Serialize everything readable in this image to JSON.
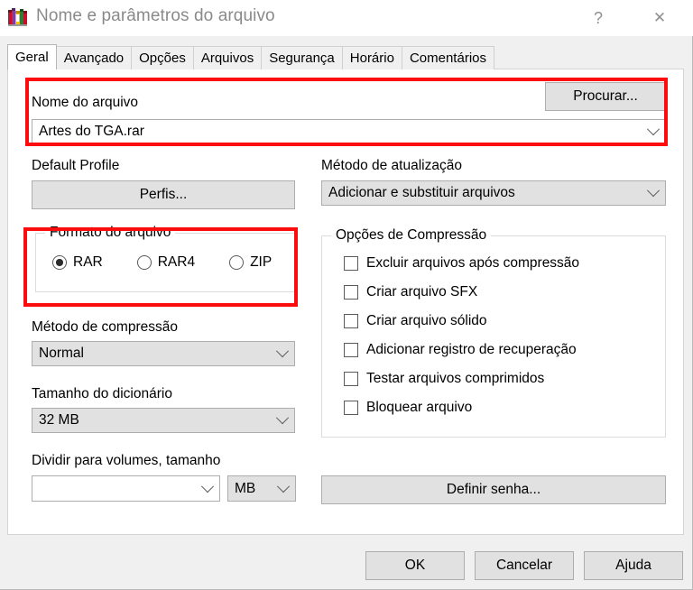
{
  "window": {
    "title": "Nome e parâmetros do arquivo",
    "icon": "winrar-books-icon",
    "help_glyph": "?",
    "close_glyph": "✕",
    "accent_highlight": "#fc0d0d"
  },
  "tabs": [
    {
      "label": "Geral",
      "active": true
    },
    {
      "label": "Avançado",
      "active": false
    },
    {
      "label": "Opções",
      "active": false
    },
    {
      "label": "Arquivos",
      "active": false
    },
    {
      "label": "Segurança",
      "active": false
    },
    {
      "label": "Horário",
      "active": false
    },
    {
      "label": "Comentários",
      "active": false
    }
  ],
  "archive_name": {
    "label": "Nome do arquivo",
    "value": "Artes do TGA.rar",
    "browse_label": "Procurar..."
  },
  "profile": {
    "label": "Default Profile",
    "button_label": "Perfis..."
  },
  "archive_format": {
    "group_title": "Formato do arquivo",
    "options": [
      {
        "label": "RAR",
        "selected": true
      },
      {
        "label": "RAR4",
        "selected": false
      },
      {
        "label": "ZIP",
        "selected": false
      }
    ]
  },
  "compression_method": {
    "label": "Método de compressão",
    "value": "Normal"
  },
  "dictionary_size": {
    "label": "Tamanho do dicionário",
    "value": "32 MB"
  },
  "split_volumes": {
    "label": "Dividir para volumes, tamanho",
    "value": "",
    "unit": "MB"
  },
  "update_method": {
    "label": "Método de atualização",
    "value": "Adicionar e substituir arquivos"
  },
  "compression_options": {
    "group_title": "Opções de Compressão",
    "items": [
      {
        "label": "Excluir arquivos após compressão",
        "checked": false
      },
      {
        "label": "Criar arquivo SFX",
        "checked": false
      },
      {
        "label": "Criar arquivo sólido",
        "checked": false
      },
      {
        "label": "Adicionar registro de recuperação",
        "checked": false
      },
      {
        "label": "Testar arquivos comprimidos",
        "checked": false
      },
      {
        "label": "Bloquear arquivo",
        "checked": false
      }
    ]
  },
  "password": {
    "button_label": "Definir senha..."
  },
  "footer": {
    "ok_label": "OK",
    "cancel_label": "Cancelar",
    "help_label": "Ajuda"
  }
}
